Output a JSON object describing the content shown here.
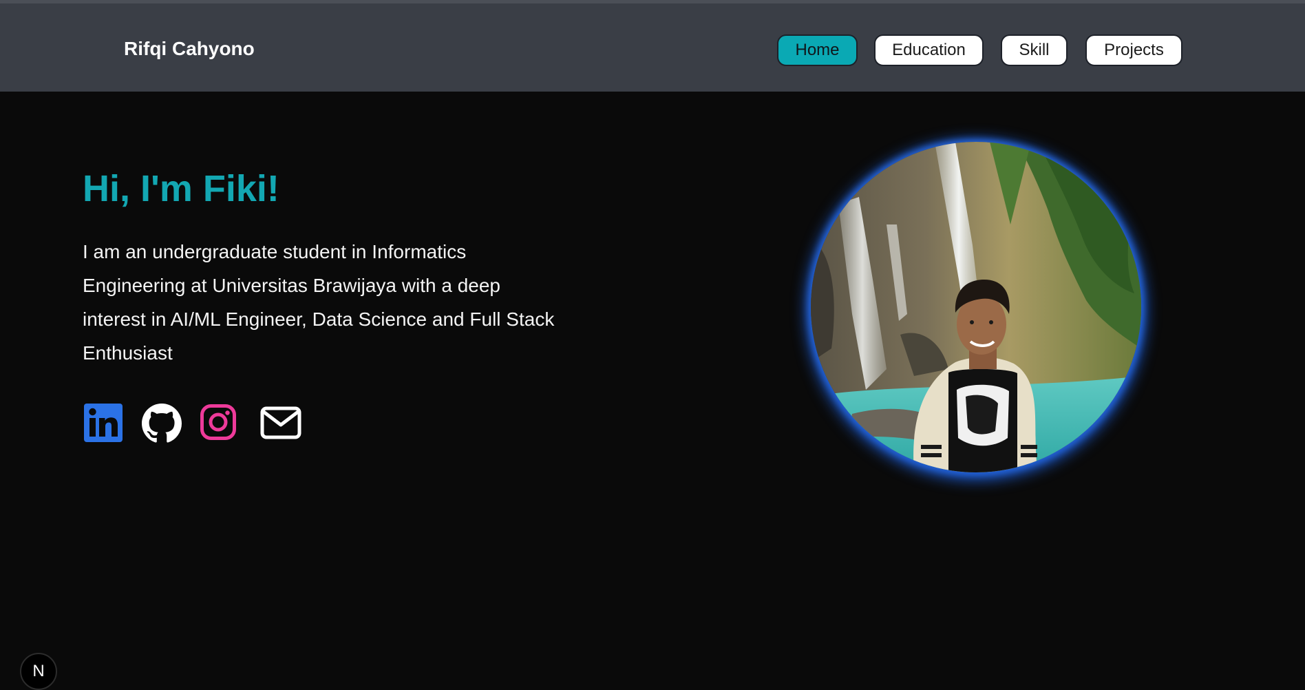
{
  "header": {
    "brand": "Rifqi Cahyono",
    "nav": [
      {
        "label": "Home",
        "active": true
      },
      {
        "label": "Education",
        "active": false
      },
      {
        "label": "Skill",
        "active": false
      },
      {
        "label": "Projects",
        "active": false
      }
    ]
  },
  "hero": {
    "greeting": "Hi, I'm Fiki!",
    "bio": "I am an undergraduate student in Informatics Engineering at Universitas Brawijaya with a deep interest in AI/ML Engineer, Data Science and Full Stack Enthusiast"
  },
  "socials": [
    {
      "icon": "linkedin-icon",
      "color": "#2b72e6"
    },
    {
      "icon": "github-icon",
      "color": "#ffffff"
    },
    {
      "icon": "instagram-icon",
      "color": "#ee3a9a"
    },
    {
      "icon": "mail-icon",
      "color": "#ffffff"
    }
  ],
  "badge": {
    "label": "N",
    "icon": "nextjs-icon"
  },
  "colors": {
    "accent": "#0aa9b4",
    "navbar": "#3a3e46",
    "background": "#0a0a0a",
    "avatar_glow": "#1f5fd6"
  },
  "profile_photo": {
    "icon": "profile-photo"
  }
}
